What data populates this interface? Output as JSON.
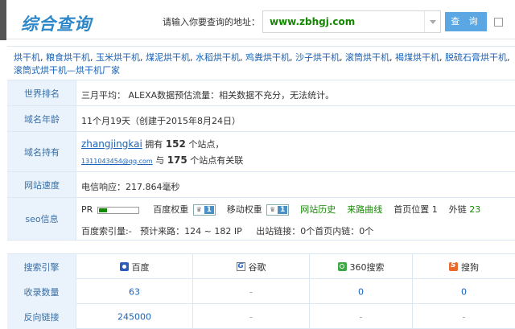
{
  "header": {
    "site_title": "综合查询",
    "prompt": "请输入你要查询的地址：",
    "search_value": "www.zbhgj.com",
    "query_button": "查 询"
  },
  "keywords": {
    "line1": [
      "烘干机",
      "粮食烘干机",
      "玉米烘干机",
      "煤泥烘干机",
      "水稻烘干机",
      "鸡粪烘干机",
      "沙子烘干机",
      "滚筒烘干机",
      "褐煤烘干机",
      "脱硫石膏烘干机"
    ],
    "line2": [
      "滚筒式烘干机—烘干机厂家"
    ]
  },
  "info": {
    "rank": {
      "label": "世界排名",
      "value": "三月平均： ALEXA数据预估流量：相关数据不充分，无法统计。"
    },
    "age": {
      "label": "域名年龄",
      "value": "11个月19天（创建于2015年8月24日）"
    },
    "owner": {
      "label": "域名持有",
      "name": "zhangjingkai",
      "owns_prefix": "拥有",
      "owns_count": "152",
      "owns_suffix": "个站点，",
      "email": "1311043454@qq.com",
      "related_prefix": "与",
      "related_count": "175",
      "related_suffix": "个站点有关联"
    },
    "speed": {
      "label": "网站速度",
      "value": "电信响应：217.864毫秒"
    },
    "seo": {
      "label": "seo信息",
      "pr_label": "PR",
      "pr_value": 0,
      "baidu_weight_label": "百度权重",
      "baidu_weight_value": "1",
      "mobile_weight_label": "移动权重",
      "mobile_weight_value": "1",
      "history_link": "网站历史",
      "traffic_link": "来路曲线",
      "home_pos_label": "首页位置",
      "home_pos_value": "1",
      "outlinks_label": "外链",
      "outlinks_value": "23",
      "line2": "百度索引量:-   预计来路：124 ~ 182 IP     出站链接：0个首页内链：0个"
    }
  },
  "engines": {
    "header_label": "搜索引擎",
    "columns": [
      {
        "name": "百度",
        "icon": "baidu-icon"
      },
      {
        "name": "谷歌",
        "icon": "google-icon"
      },
      {
        "name": "360搜索",
        "icon": "360-icon"
      },
      {
        "name": "搜狗",
        "icon": "sogou-icon"
      }
    ],
    "rows": [
      {
        "label": "收录数量",
        "values": [
          "63",
          "-",
          "0",
          "0"
        ]
      },
      {
        "label": "反向链接",
        "values": [
          "245000",
          "-",
          "-",
          "-"
        ]
      }
    ]
  },
  "colors": {
    "accent_blue": "#2e87c8",
    "link_blue": "#1a63b8",
    "green": "#138900",
    "label_bg": "#eaf3fb"
  }
}
